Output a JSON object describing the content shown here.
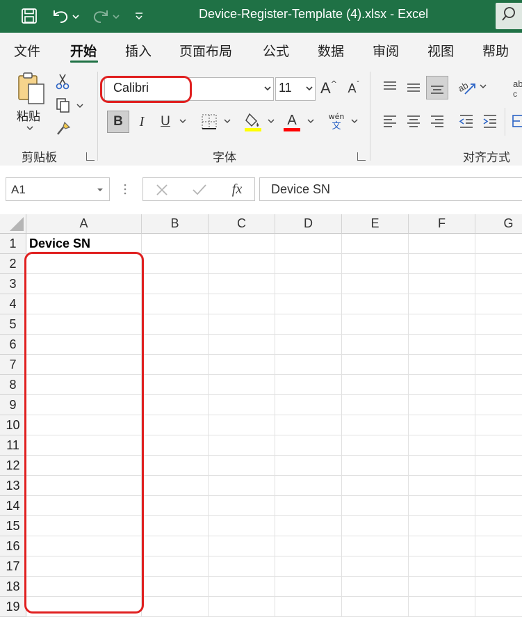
{
  "titlebar": {
    "title": "Device-Register-Template (4).xlsx  -  Excel",
    "bg_color": "#1f7145",
    "icons": [
      "save-icon",
      "undo-icon",
      "redo-icon",
      "customize-quick-access-icon",
      "search-icon"
    ]
  },
  "menu": {
    "items": [
      "文件",
      "开始",
      "插入",
      "页面布局",
      "公式",
      "数据",
      "审阅",
      "视图",
      "帮助"
    ],
    "active": "开始"
  },
  "ribbon": {
    "clipboard": {
      "paste_label": "粘贴",
      "group_label": "剪贴板"
    },
    "font": {
      "font_name": "Calibri",
      "font_size": "11",
      "bold": "B",
      "italic": "I",
      "underline": "U",
      "font_color_letter": "A",
      "phonetic_top": "wén",
      "phonetic_bottom": "文",
      "grow_font": "A",
      "shrink_font": "A",
      "group_label": "字体",
      "highlight_color": "#ffff00",
      "font_color": "#ff0000"
    },
    "alignment": {
      "group_label": "对齐方式"
    }
  },
  "formula_bar": {
    "name_box": "A1",
    "fx_label": "fx",
    "formula": "Device SN"
  },
  "sheet": {
    "columns": [
      "A",
      "B",
      "C",
      "D",
      "E",
      "F",
      "G"
    ],
    "rows": [
      "1",
      "2",
      "3",
      "4",
      "5",
      "6",
      "7",
      "8",
      "9",
      "10",
      "11",
      "12",
      "13",
      "14",
      "15",
      "16",
      "17",
      "18",
      "19"
    ],
    "cell_A1": "Device SN"
  },
  "annotation_color": "#e02020"
}
